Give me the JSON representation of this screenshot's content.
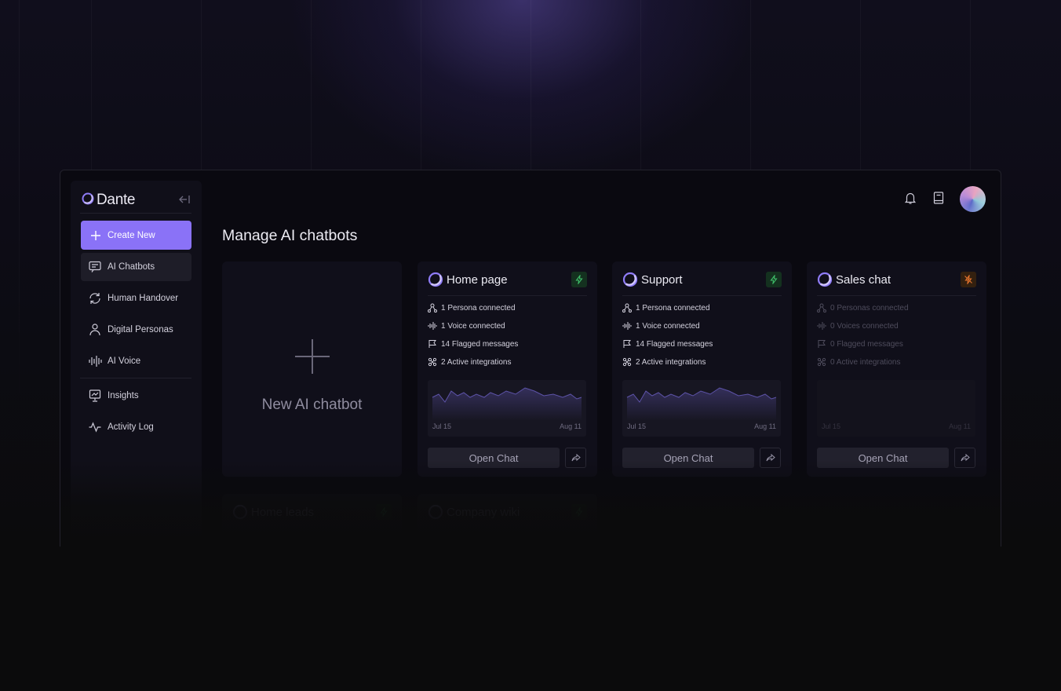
{
  "sidebar": {
    "brand": "Dante",
    "create_label": "Create New",
    "items": [
      {
        "label": "AI Chatbots",
        "icon": "chatbot-icon"
      },
      {
        "label": "Human Handover",
        "icon": "handover-icon"
      },
      {
        "label": "Digital Personas",
        "icon": "persona-icon"
      },
      {
        "label": "AI Voice",
        "icon": "voice-wave-icon"
      },
      {
        "label": "Insights",
        "icon": "insights-icon"
      },
      {
        "label": "Activity Log",
        "icon": "activity-icon"
      }
    ]
  },
  "header": {
    "title": "Manage AI chatbots"
  },
  "new_card": {
    "label": "New AI chatbot"
  },
  "cards": [
    {
      "name": "Home page",
      "status": "active",
      "stats": [
        "1 Persona connected",
        "1 Voice connected",
        "14 Flagged messages",
        "2 Active integrations"
      ],
      "chart_start": "Jul 15",
      "chart_end": "Aug 11",
      "open_label": "Open Chat"
    },
    {
      "name": "Support",
      "status": "active",
      "stats": [
        "1 Persona connected",
        "1 Voice connected",
        "14 Flagged messages",
        "2 Active integrations"
      ],
      "chart_start": "Jul 15",
      "chart_end": "Aug 11",
      "open_label": "Open Chat"
    },
    {
      "name": "Sales chat",
      "status": "inactive",
      "stats": [
        "0 Personas connected",
        "0 Voices connected",
        "0 Flagged messages",
        "0 Active integrations"
      ],
      "chart_start": "Jul 15",
      "chart_end": "Aug 11",
      "open_label": "Open Chat"
    }
  ],
  "ghost_cards": [
    {
      "name": "Home leads"
    },
    {
      "name": "Company wiki"
    }
  ],
  "colors": {
    "accent": "#8a72f7",
    "active": "#3fbf6a",
    "inactive": "#e6742e"
  }
}
